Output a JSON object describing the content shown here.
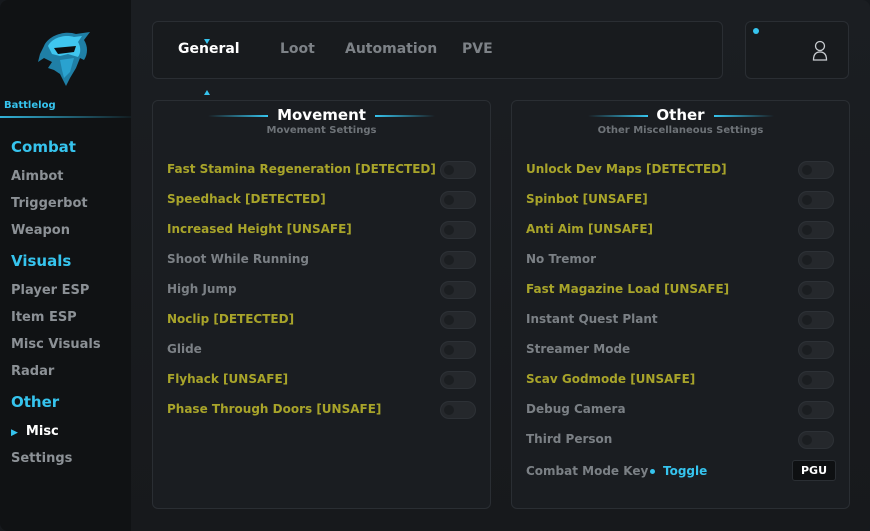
{
  "sidebar": {
    "brand": "Battlelog",
    "sections": [
      {
        "label": "Combat",
        "items": [
          "Aimbot",
          "Triggerbot",
          "Weapon"
        ]
      },
      {
        "label": "Visuals",
        "items": [
          "Player ESP",
          "Item ESP",
          "Misc Visuals",
          "Radar"
        ]
      },
      {
        "label": "Other",
        "items": [
          "Misc",
          "Settings"
        ]
      }
    ],
    "active_item": "Misc"
  },
  "tabs": [
    {
      "label": "General",
      "active": true
    },
    {
      "label": "Loot",
      "active": false
    },
    {
      "label": "Automation",
      "active": false
    },
    {
      "label": "PVE",
      "active": false
    }
  ],
  "panels": {
    "movement": {
      "title": "Movement",
      "subtitle": "Movement Settings",
      "rows": [
        {
          "label": "Fast Stamina Regeneration [DETECTED]",
          "enabled": false
        },
        {
          "label": "Speedhack [DETECTED]",
          "enabled": false
        },
        {
          "label": "Increased Height [UNSAFE]",
          "enabled": false
        },
        {
          "label": "Shoot While Running",
          "enabled": false
        },
        {
          "label": "High Jump",
          "enabled": false
        },
        {
          "label": "Noclip [DETECTED]",
          "enabled": false
        },
        {
          "label": "Glide",
          "enabled": false
        },
        {
          "label": "Flyhack [UNSAFE]",
          "enabled": false
        },
        {
          "label": "Phase Through Doors [UNSAFE]",
          "enabled": false
        }
      ]
    },
    "other": {
      "title": "Other",
      "subtitle": "Other Miscellaneous Settings",
      "rows": [
        {
          "label": "Unlock Dev Maps [DETECTED]",
          "enabled": false
        },
        {
          "label": "Spinbot [UNSAFE]",
          "enabled": false
        },
        {
          "label": "Anti Aim [UNSAFE]",
          "enabled": false
        },
        {
          "label": "No Tremor",
          "enabled": false
        },
        {
          "label": "Fast Magazine Load [UNSAFE]",
          "enabled": false
        },
        {
          "label": "Instant Quest Plant",
          "enabled": false
        },
        {
          "label": "Streamer Mode",
          "enabled": false
        },
        {
          "label": "Scav Godmode [UNSAFE]",
          "enabled": false
        },
        {
          "label": "Debug Camera",
          "enabled": false
        },
        {
          "label": "Third Person",
          "enabled": false
        }
      ],
      "key_label": "Combat Mode Key",
      "key_mode": "Toggle",
      "key_value": "PGU"
    }
  },
  "colors": {
    "accent": "#36c4ee",
    "warning_text": "#a8a42a",
    "normal_text": "#7b8085",
    "background": "#16191d"
  },
  "icons": {
    "logo": "knight-helmet-logo",
    "user": "user-icon"
  }
}
